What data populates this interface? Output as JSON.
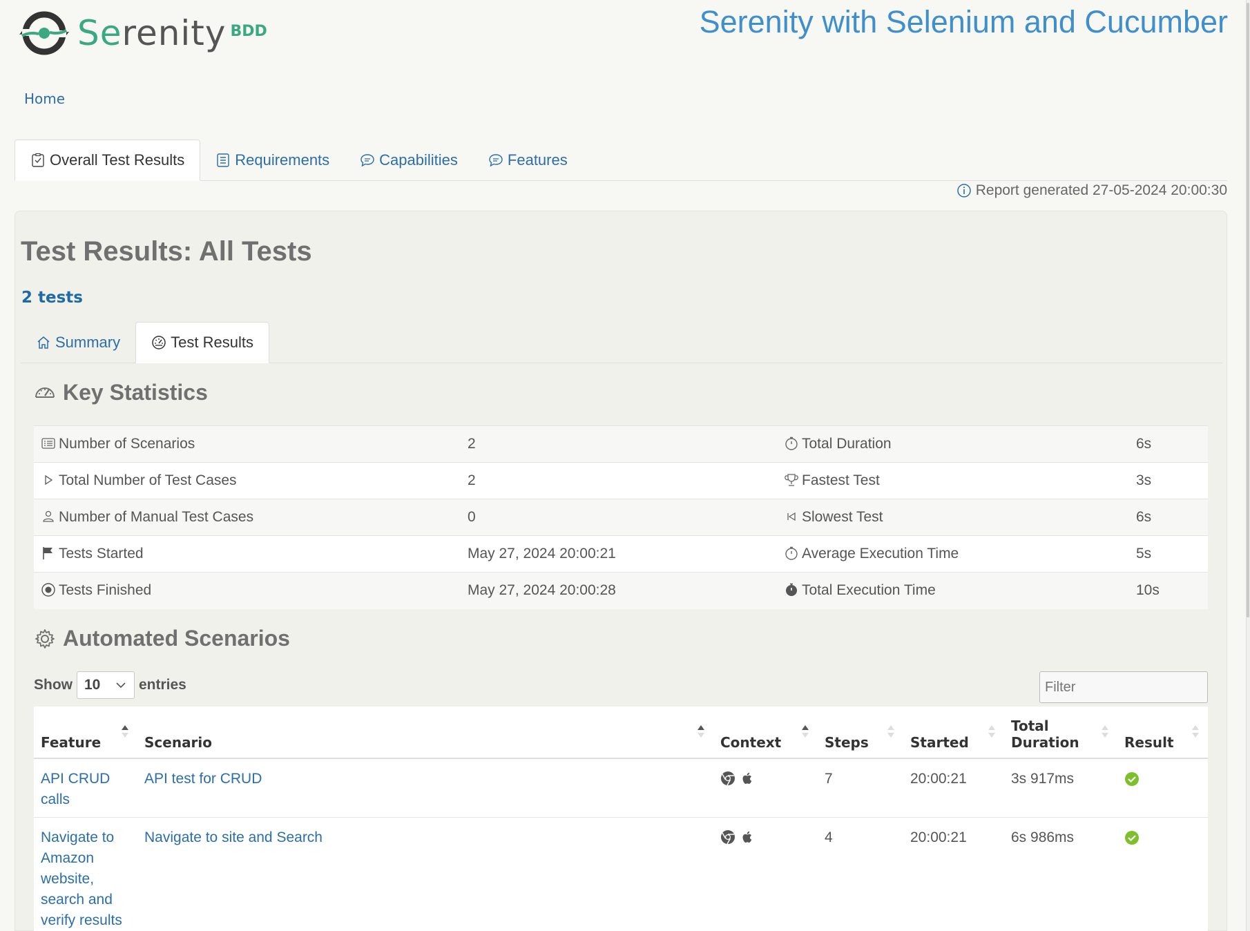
{
  "header": {
    "logo_word_accent": "Se",
    "logo_word_rest": "renity",
    "logo_sub": "BDD",
    "project_title": "Serenity with Selenium and Cucumber"
  },
  "breadcrumb": {
    "home": "Home"
  },
  "top_tabs": [
    {
      "label": "Overall Test Results",
      "icon": "checklist-icon",
      "active": true
    },
    {
      "label": "Requirements",
      "icon": "document-icon",
      "active": false
    },
    {
      "label": "Capabilities",
      "icon": "chat-icon",
      "active": false
    },
    {
      "label": "Features",
      "icon": "chat-icon",
      "active": false
    }
  ],
  "report_generated": "Report generated 27-05-2024 20:00:30",
  "main": {
    "title": "Test Results: All Tests",
    "tests_count": "2 tests",
    "tabs": [
      {
        "label": "Summary",
        "icon": "home-icon",
        "active": false
      },
      {
        "label": "Test Results",
        "icon": "gauge-icon",
        "active": true
      }
    ]
  },
  "key_statistics": {
    "heading": "Key Statistics",
    "rows": [
      {
        "label1": "Number of Scenarios",
        "icon1": "list-icon",
        "value1": "2",
        "label2": "Total Duration",
        "icon2": "stopwatch-icon",
        "value2": "6s"
      },
      {
        "label1": "Total Number of Test Cases",
        "icon1": "play-icon",
        "value1": "2",
        "label2": "Fastest Test",
        "icon2": "trophy-icon",
        "value2": "3s"
      },
      {
        "label1": "Number of Manual Test Cases",
        "icon1": "person-icon",
        "value1": "0",
        "label2": "Slowest Test",
        "icon2": "rewind-icon",
        "value2": "6s"
      },
      {
        "label1": "Tests Started",
        "icon1": "flag-icon",
        "value1": "May 27, 2024 20:00:21",
        "label2": "Average Execution Time",
        "icon2": "stopwatch-icon",
        "value2": "5s"
      },
      {
        "label1": "Tests Finished",
        "icon1": "record-icon",
        "value1": "May 27, 2024 20:00:28",
        "label2": "Total Execution Time",
        "icon2": "stopwatch-filled-icon",
        "value2": "10s"
      }
    ]
  },
  "automated_scenarios": {
    "heading": "Automated Scenarios",
    "show_label": "Show",
    "entries_value": "10",
    "entries_label": "entries",
    "filter_placeholder": "Filter",
    "columns": {
      "feature": "Feature",
      "scenario": "Scenario",
      "context": "Context",
      "steps": "Steps",
      "started": "Started",
      "total_line1": "Total",
      "total_line2": "Duration",
      "result": "Result"
    },
    "rows": [
      {
        "feature": "API CRUD calls",
        "scenario": "API test for CRUD",
        "steps": "7",
        "started": "20:00:21",
        "duration": "3s 917ms",
        "result": "success"
      },
      {
        "feature": "Navigate to Amazon website, search and verify results",
        "scenario": "Navigate to site and Search",
        "steps": "4",
        "started": "20:00:21",
        "duration": "6s 986ms",
        "result": "success"
      }
    ],
    "colors": {
      "success": "#7dc02b",
      "link": "#2b6ea8",
      "accent": "#3aa882"
    }
  }
}
